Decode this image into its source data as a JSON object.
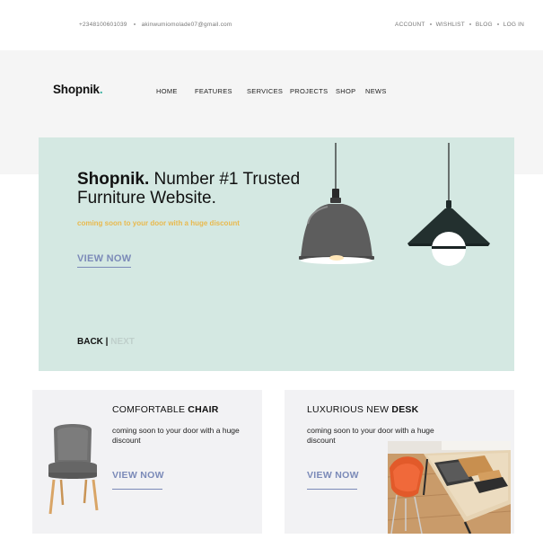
{
  "topbar": {
    "phone": "+2348100601039",
    "email": "akinwumiomolade07@gmail.com",
    "links": [
      "ACCOUNT",
      "WISHLIST",
      "BLOG",
      "LOG IN"
    ]
  },
  "brand": {
    "name": "Shopnik",
    "dot": "."
  },
  "nav": [
    "HOME",
    "FEATURES",
    "SERVICES",
    "PROJECTS",
    "SHOP",
    "NEWS"
  ],
  "hero": {
    "title_bold": "Shopnik.",
    "title_rest": " Number #1 Trusted Furniture Website.",
    "subtitle": "coming soon to your door with a huge discount",
    "cta": "VIEW NOW",
    "back": "BACK",
    "separator": " | ",
    "next": "NEXT"
  },
  "cards": [
    {
      "title_plain": "COMFORTABLE ",
      "title_bold": "CHAIR",
      "description": "coming soon to your door with a huge discount",
      "cta": "VIEW NOW"
    },
    {
      "title_plain": "LUXURIOUS NEW ",
      "title_bold": "DESK",
      "description": "coming soon to your door with a huge discount",
      "cta": "VIEW NOW"
    }
  ],
  "colors": {
    "hero_bg": "#d4e8e2",
    "accent_blue": "#7b8ab8",
    "accent_yellow": "#e9b94d",
    "card_bg": "#f2f2f4"
  }
}
